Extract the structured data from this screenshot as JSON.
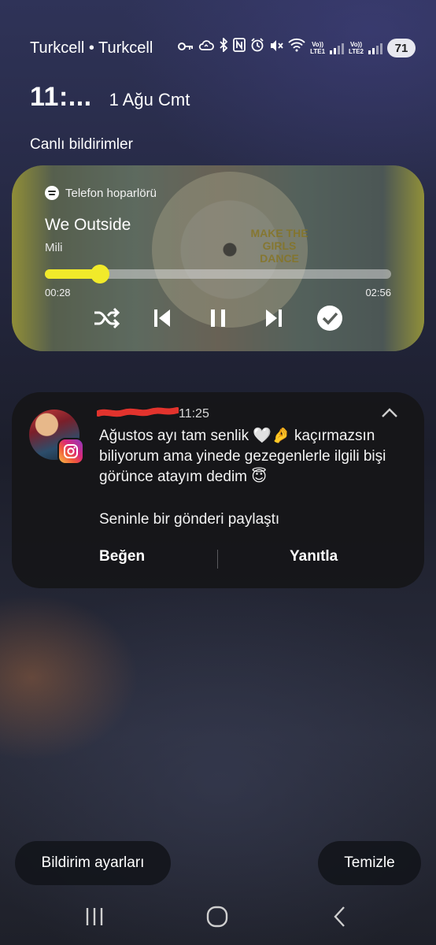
{
  "status_bar": {
    "carrier": "Turkcell • Turkcell",
    "battery": "71",
    "icons": [
      "key-icon",
      "cloud-sync-icon",
      "bluetooth-icon",
      "nfc-icon",
      "alarm-icon",
      "mute-icon",
      "wifi-icon",
      "volte-lte1-icon",
      "signal-1-icon",
      "volte-lte2-icon",
      "signal-2-icon"
    ],
    "lte1_top": "Vo))",
    "lte1_bottom": "LTE1",
    "lte2_top": "Vo))",
    "lte2_bottom": "LTE2"
  },
  "clock": {
    "time": "11:...",
    "date": "1 Ağu Cmt"
  },
  "live_notifications": {
    "section_title": "Canlı bildirimler",
    "media": {
      "output_device": "Telefon hoparlörü",
      "title": "We Outside",
      "artist": "Mili",
      "elapsed": "00:28",
      "duration": "02:56",
      "progress": 0.159,
      "album_art_text": "MAKE THE GIRLS DANCE",
      "accent_color": "#f1ea2a"
    }
  },
  "message_notification": {
    "time": "11:25",
    "app_icon": "instagram-icon",
    "body": "Ağustos ayı tam senlik 🤍🤌 kaçırmazsın biliyorum ama yinede gezegenlerle ilgili bişi görünce atayım dedim 😇",
    "subtext": "Seninle bir gönderi paylaştı",
    "actions": {
      "like": "Beğen",
      "reply": "Yanıtla"
    }
  },
  "footer": {
    "settings_button": "Bildirim ayarları",
    "clear_button": "Temizle"
  }
}
